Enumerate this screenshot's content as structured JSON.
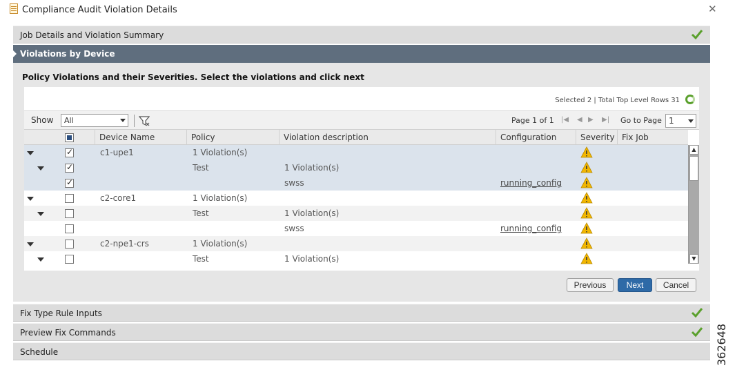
{
  "window": {
    "title": "Compliance Audit Violation Details"
  },
  "sections": {
    "job_details": "Job Details and Violation Summary",
    "violations_by_device": "Violations by Device",
    "fix_type_rule_inputs": "Fix Type Rule Inputs",
    "preview_fix_commands": "Preview Fix Commands",
    "schedule": "Schedule"
  },
  "instruction": "Policy Violations and their Severities. Select the violations and click next",
  "grid": {
    "selected_info": "Selected 2 | Total Top Level Rows 31",
    "show_label": "Show",
    "show_value": "All",
    "page_info": "Page 1 of 1",
    "goto_label": "Go to Page",
    "goto_value": "1",
    "columns": [
      "Device Name",
      "Policy",
      "Violation description",
      "Configuration",
      "Severity",
      "Fix Job"
    ],
    "rows": [
      {
        "level": 0,
        "checked": true,
        "device": "c1-upe1",
        "policy": "1 Violation(s)",
        "description": "",
        "configuration": "",
        "severity": "warning",
        "selected": true
      },
      {
        "level": 1,
        "checked": true,
        "device": "",
        "policy": "Test",
        "description": "1 Violation(s)",
        "configuration": "",
        "severity": "warning",
        "selected": true
      },
      {
        "level": 2,
        "checked": true,
        "device": "",
        "policy": "",
        "description": "swss",
        "configuration": "running_config",
        "severity": "warning",
        "selected": true
      },
      {
        "level": 0,
        "checked": false,
        "device": "c2-core1",
        "policy": "1 Violation(s)",
        "description": "",
        "configuration": "",
        "severity": "warning",
        "selected": false
      },
      {
        "level": 1,
        "checked": false,
        "device": "",
        "policy": "Test",
        "description": "1 Violation(s)",
        "configuration": "",
        "severity": "warning",
        "selected": false
      },
      {
        "level": 2,
        "checked": false,
        "device": "",
        "policy": "",
        "description": "swss",
        "configuration": "running_config",
        "severity": "warning",
        "selected": false
      },
      {
        "level": 0,
        "checked": false,
        "device": "c2-npe1-crs",
        "policy": "1 Violation(s)",
        "description": "",
        "configuration": "",
        "severity": "warning",
        "selected": false
      },
      {
        "level": 1,
        "checked": false,
        "device": "",
        "policy": "Test",
        "description": "1 Violation(s)",
        "configuration": "",
        "severity": "warning",
        "selected": false
      }
    ]
  },
  "buttons": {
    "previous": "Previous",
    "next": "Next",
    "cancel": "Cancel"
  },
  "side_id": "362648",
  "colors": {
    "active_section": "#5f6e7e",
    "selected_row": "#dbe3ec",
    "primary_button": "#2e6aa7",
    "warning": "#f2b600",
    "check": "#5aa02c"
  }
}
